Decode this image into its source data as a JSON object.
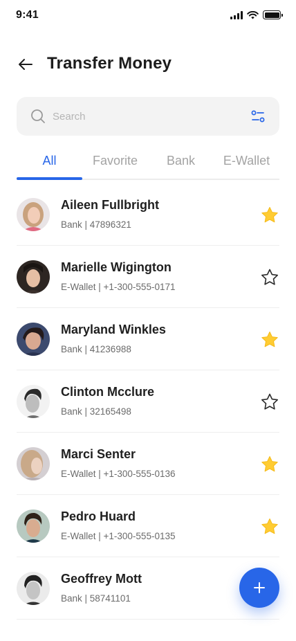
{
  "status_bar": {
    "time": "9:41"
  },
  "header": {
    "title": "Transfer Money"
  },
  "search": {
    "placeholder": "Search"
  },
  "tabs": [
    {
      "label": "All",
      "active": true
    },
    {
      "label": "Favorite",
      "active": false
    },
    {
      "label": "Bank",
      "active": false
    },
    {
      "label": "E-Wallet",
      "active": false
    }
  ],
  "contacts": [
    {
      "name": "Aileen Fullbright",
      "detail": "Bank | 47896321",
      "favorite": true
    },
    {
      "name": "Marielle Wigington",
      "detail": "E-Wallet | +1-300-555-0171",
      "favorite": false
    },
    {
      "name": "Maryland Winkles",
      "detail": "Bank | 41236988",
      "favorite": true
    },
    {
      "name": "Clinton Mcclure",
      "detail": "Bank | 32165498",
      "favorite": false
    },
    {
      "name": "Marci Senter",
      "detail": "E-Wallet | +1-300-555-0136",
      "favorite": true
    },
    {
      "name": "Pedro Huard",
      "detail": "E-Wallet | +1-300-555-0135",
      "favorite": true
    },
    {
      "name": "Geoffrey Mott",
      "detail": "Bank | 58741101",
      "favorite": false
    }
  ],
  "colors": {
    "accent": "#2866e8",
    "star_filled": "#ffcc33",
    "star_outline": "#2a2a2a"
  },
  "icons": {
    "back": "arrow-left-icon",
    "search": "search-icon",
    "filter": "filter-icon",
    "favorite_on": "star-filled-icon",
    "favorite_off": "star-outline-icon",
    "add": "plus-icon"
  }
}
